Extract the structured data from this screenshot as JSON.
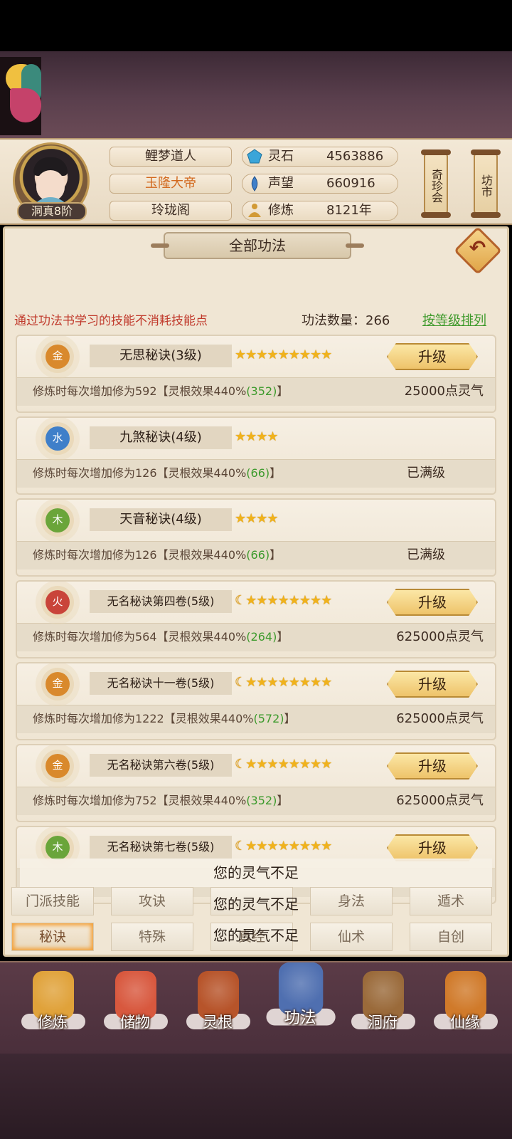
{
  "player": {
    "rank": "洞真8阶",
    "name": "鲤梦道人",
    "title": "玉隆大帝",
    "sect": "玲珑阁"
  },
  "stats": [
    {
      "label": "灵石",
      "value": "4563886",
      "icon": "spirit-stone-icon",
      "color": "#3aa5d9"
    },
    {
      "label": "声望",
      "value": "660916",
      "icon": "prestige-icon",
      "color": "#3f7fc9"
    },
    {
      "label": "修炼",
      "value": "8121年",
      "icon": "meditation-icon",
      "color": "#d29a35"
    }
  ],
  "side_buttons": [
    {
      "label": "奇珍会"
    },
    {
      "label": "坊市"
    }
  ],
  "panel": {
    "title": "全部功法",
    "hint": "通过功法书学习的技能不消耗技能点",
    "count_label": "功法数量：266",
    "sort_label": "按等级排列"
  },
  "skills": [
    {
      "element": "金",
      "element_color": "#d9892c",
      "name": "无思秘诀(3级)",
      "moon": false,
      "stars": 9,
      "desc_prefix": "修炼时每次增加修为592【灵根效果440%",
      "desc_bonus": "(352)",
      "desc_suffix": "】",
      "action": "升级",
      "cost": "25000点灵气"
    },
    {
      "element": "水",
      "element_color": "#3f7fc9",
      "name": "九煞秘诀(4级)",
      "moon": false,
      "stars": 4,
      "desc_prefix": "修炼时每次增加修为126【灵根效果440%",
      "desc_bonus": "(66)",
      "desc_suffix": "】",
      "status": "已满级"
    },
    {
      "element": "木",
      "element_color": "#6aa53a",
      "name": "天音秘诀(4级)",
      "moon": false,
      "stars": 4,
      "desc_prefix": "修炼时每次增加修为126【灵根效果440%",
      "desc_bonus": "(66)",
      "desc_suffix": "】",
      "status": "已满级"
    },
    {
      "element": "火",
      "element_color": "#c9443a",
      "name": "无名秘诀第四卷(5级)",
      "moon": true,
      "stars": 8,
      "desc_prefix": "修炼时每次增加修为564【灵根效果440%",
      "desc_bonus": "(264)",
      "desc_suffix": "】",
      "action": "升级",
      "cost": "625000点灵气"
    },
    {
      "element": "金",
      "element_color": "#d9892c",
      "name": "无名秘诀十一卷(5级)",
      "moon": true,
      "stars": 8,
      "desc_prefix": "修炼时每次增加修为1222【灵根效果440%",
      "desc_bonus": "(572)",
      "desc_suffix": "】",
      "action": "升级",
      "cost": "625000点灵气"
    },
    {
      "element": "金",
      "element_color": "#d9892c",
      "name": "无名秘诀第六卷(5级)",
      "moon": true,
      "stars": 8,
      "desc_prefix": "修炼时每次增加修为752【灵根效果440%",
      "desc_bonus": "(352)",
      "desc_suffix": "】",
      "action": "升级",
      "cost": "625000点灵气"
    },
    {
      "element": "木",
      "element_color": "#6aa53a",
      "name": "无名秘诀第七卷(5级)",
      "moon": true,
      "stars": 8,
      "action": "升级"
    }
  ],
  "toasts": [
    "您的灵气不足",
    "您的灵气不足",
    "您的灵气不足"
  ],
  "categories_row1": [
    "门派技能",
    "攻诀",
    "",
    "身法",
    "遁术"
  ],
  "categories_row2": [
    "秘诀",
    "特殊",
    "真经",
    "仙术",
    "自创"
  ],
  "active_category": "秘诀",
  "nav": [
    {
      "label": "修炼",
      "icon": "cultivation-icon",
      "color": "#e0a23a"
    },
    {
      "label": "储物",
      "icon": "storage-bag-icon",
      "color": "#d8583e"
    },
    {
      "label": "灵根",
      "icon": "spirit-root-icon",
      "color": "#b7542a"
    },
    {
      "label": "功法",
      "icon": "skill-book-icon",
      "color": "#4f6fb0"
    },
    {
      "label": "洞府",
      "icon": "cave-dwelling-icon",
      "color": "#9a6a3a"
    },
    {
      "label": "仙缘",
      "icon": "gourd-icon",
      "color": "#d07a2a"
    }
  ],
  "active_nav": "功法"
}
